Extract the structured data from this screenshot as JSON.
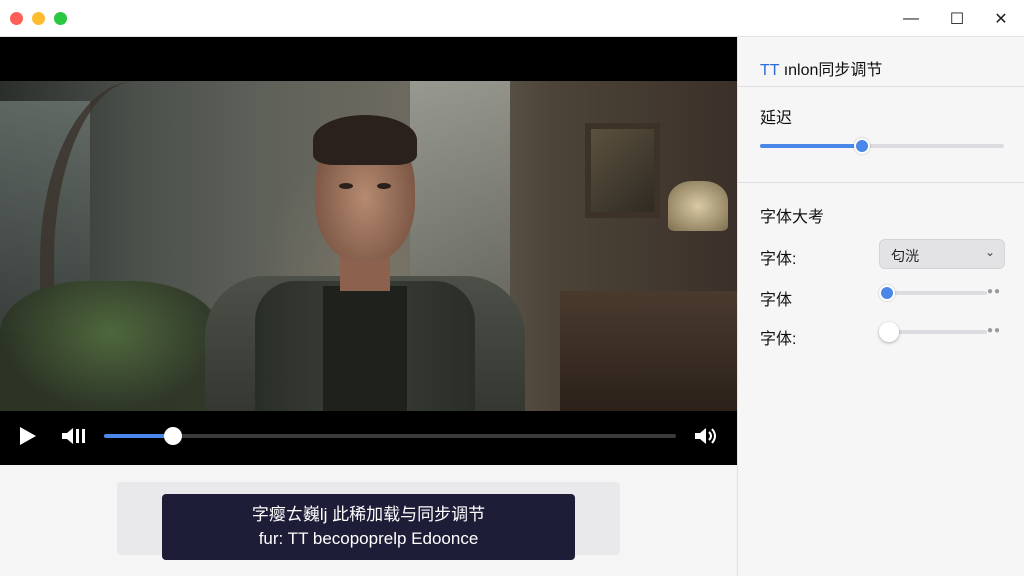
{
  "window": {
    "controls": {
      "minimize": "—",
      "maximize": "☐",
      "close": "✕"
    }
  },
  "player": {
    "progress": 0.12
  },
  "subtitle": {
    "line1": "字瘿ㄊ巍lj 此稀加载与同步调节",
    "line2": "fur: TT becopoprelp Edoonce"
  },
  "panel": {
    "title_prefix": "TT",
    "title_rest": " ınlon同步调节",
    "delay": {
      "label": "延迟",
      "value": 0.42
    },
    "font_section": {
      "label": "字体大考"
    },
    "rows": [
      {
        "label": "字体:",
        "select_value": "匂洸"
      },
      {
        "label": "字体",
        "value": 0.0
      },
      {
        "label": "字体:",
        "value": 0.06
      }
    ]
  },
  "colors": {
    "accent": "#4a87e8",
    "subtitle_bg": "#1d1d38"
  }
}
